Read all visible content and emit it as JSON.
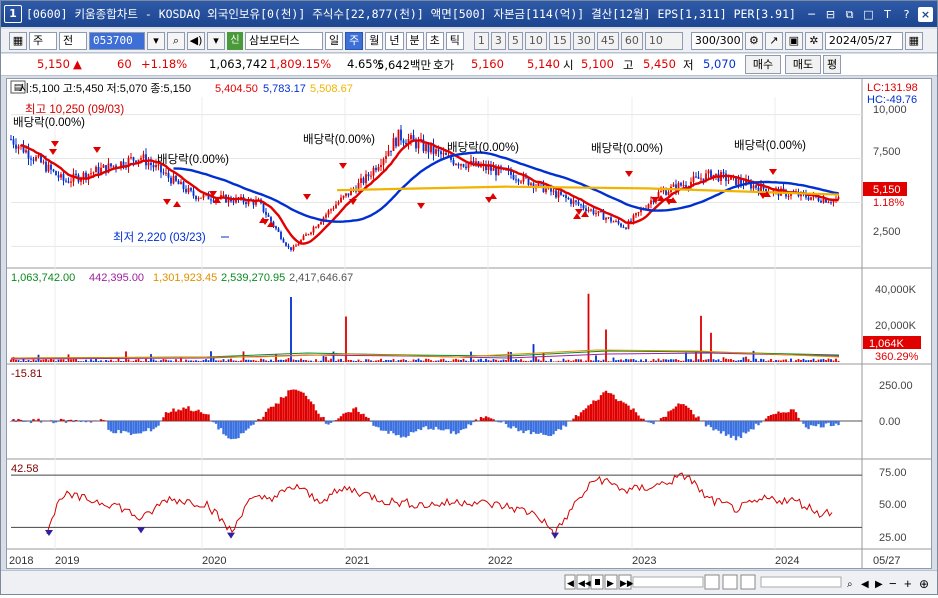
{
  "window": {
    "number": "1",
    "title": "[0600] 키움종합차트 - KOSDAQ 외국인보유[0(천)] 주식수[22,877(천)] 액면[500] 자본금[114(억)] 결산[12월] EPS[1,311] PER[3.91]"
  },
  "toolbar": {
    "type1": "주",
    "type2": "전",
    "code": "053700",
    "name": "삼보모터스",
    "periods": [
      "일",
      "주",
      "월",
      "년",
      "분",
      "초",
      "틱"
    ],
    "active_period": "주",
    "intervals": [
      "1",
      "3",
      "5",
      "10",
      "15",
      "30",
      "45",
      "60"
    ],
    "interval_select": "10",
    "count": "300/300",
    "date": "2024/05/27"
  },
  "pricebar": {
    "price": "5,150",
    "change": "60",
    "change_pct": "+1.18%",
    "volume": "1,063,742",
    "vol_pct": "1,809.15%",
    "turnover": "4.65%",
    "amount": "5,642백만",
    "bid_label": "호가",
    "bid": "5,160",
    "ask": "5,140",
    "open_label": "시",
    "open": "5,100",
    "high_label": "고",
    "high": "5,450",
    "low_label": "저",
    "low": "5,070",
    "buy": "매수",
    "sell": "매도",
    "eval": "평"
  },
  "price_panel": {
    "ohlc_label": "시:5,100 고:5,450 저:5,070 종:5,150",
    "ma1": "5,404.50",
    "ma2": "5,783.17",
    "ma3": "5,508.67",
    "lc_label": "LC:131.98",
    "hc_label": "HC:-49.76",
    "high_annot": "최고 10,250 (09/03)",
    "low_annot": "최저 2,220 (03/23)",
    "dividend_label": "배당락(0.00%)",
    "y_ticks": [
      "10,000",
      "7,500",
      "5,000",
      "2,500"
    ],
    "last_tag": "5,150",
    "last_pct": "1.18%"
  },
  "volume_panel": {
    "v1": "1,063,742.00",
    "v2": "442,395.00",
    "v3": "1,301,923.45",
    "v4": "2,539,270.95",
    "v5": "2,417,646.67",
    "y_ticks": [
      "40,000K",
      "20,000K"
    ],
    "last_tag": "1,064K",
    "last_pct": "360.29%"
  },
  "cci_panel": {
    "value": "-15.81",
    "y_ticks": [
      "250.00",
      "0.00"
    ]
  },
  "rsi_panel": {
    "value": "42.58",
    "y_ticks": [
      "75.00",
      "50.00",
      "25.00"
    ]
  },
  "x_axis": {
    "labels": [
      "2018",
      "2019",
      "2020",
      "2021",
      "2022",
      "2023",
      "2024"
    ],
    "right_label": "05/27"
  },
  "colors": {
    "up": "#e00000",
    "down": "#0030d0",
    "ma_red": "#e00000",
    "ma_blue": "#0030d0",
    "ma_yellow": "#f0b400",
    "title_bg": "#2451a0"
  },
  "chart_data": {
    "type": "candlestick",
    "title": "",
    "x_range": [
      "2018-01",
      "2024-05"
    ],
    "price_ylim": [
      1500,
      11000
    ],
    "weekly_close_sample": [
      {
        "date": "2018-01",
        "close": 8600
      },
      {
        "date": "2018-06",
        "close": 6200
      },
      {
        "date": "2019-01",
        "close": 7600
      },
      {
        "date": "2019-06",
        "close": 5400
      },
      {
        "date": "2019-12",
        "close": 5000
      },
      {
        "date": "2020-03",
        "close": 2220
      },
      {
        "date": "2020-07",
        "close": 4800
      },
      {
        "date": "2020-10",
        "close": 6400
      },
      {
        "date": "2021-01",
        "close": 8800
      },
      {
        "date": "2021-06",
        "close": 7400
      },
      {
        "date": "2021-12",
        "close": 6500
      },
      {
        "date": "2022-06",
        "close": 4800
      },
      {
        "date": "2022-10",
        "close": 3600
      },
      {
        "date": "2023-01",
        "close": 5500
      },
      {
        "date": "2023-06",
        "close": 6600
      },
      {
        "date": "2023-12",
        "close": 5600
      },
      {
        "date": "2024-05",
        "close": 5150
      }
    ],
    "volume_ylim": [
      0,
      48000000
    ],
    "cci_ylim": [
      -300,
      300
    ],
    "rsi_ylim": [
      15,
      80
    ],
    "rsi_levels": [
      70,
      30
    ]
  }
}
